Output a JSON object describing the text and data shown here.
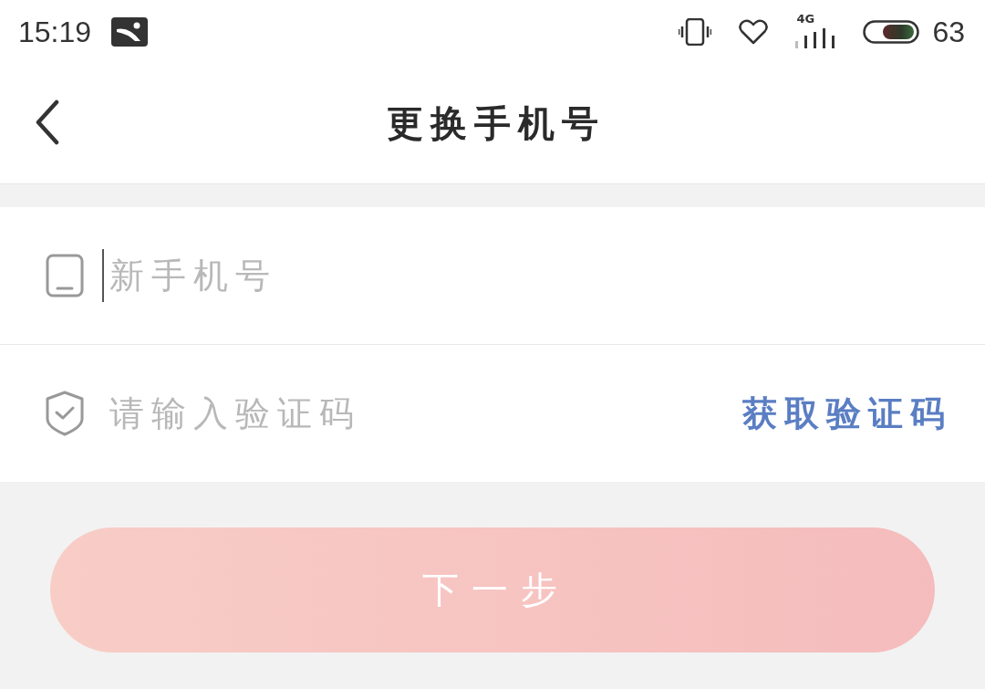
{
  "status_bar": {
    "time": "15:19",
    "network": "4G",
    "battery": "63"
  },
  "header": {
    "title": "更换手机号"
  },
  "form": {
    "fields": [
      {
        "kind": "phone",
        "placeholder": "新手机号",
        "focused": true
      },
      {
        "kind": "code",
        "placeholder": "请输入验证码",
        "focused": false,
        "action": "获取验证码"
      }
    ]
  },
  "next_button": {
    "label": "下一步",
    "disabled": true
  }
}
